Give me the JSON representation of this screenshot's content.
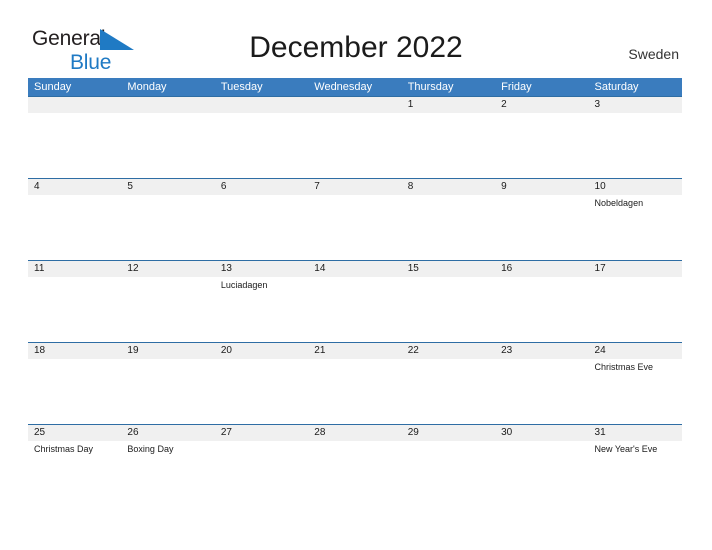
{
  "brand": {
    "word1": "General",
    "word2": "Blue",
    "flag_icon": "blue-triangle-flag-icon",
    "colors": {
      "general": "#231f20",
      "blue": "#1f7ac4",
      "flag": "#1f7ac4"
    }
  },
  "header": {
    "title": "December 2022",
    "country": "Sweden"
  },
  "theme": {
    "header_bar": "#3a7cbe",
    "row_divider": "#2e6da4",
    "date_strip": "#f0f0f0",
    "text": "#1b1b1b",
    "page_background": "#ffffff"
  },
  "calendar": {
    "weekdays": [
      "Sunday",
      "Monday",
      "Tuesday",
      "Wednesday",
      "Thursday",
      "Friday",
      "Saturday"
    ],
    "weeks": [
      {
        "dates": [
          "",
          "",
          "",
          "",
          "1",
          "2",
          "3"
        ],
        "events": [
          "",
          "",
          "",
          "",
          "",
          "",
          ""
        ]
      },
      {
        "dates": [
          "4",
          "5",
          "6",
          "7",
          "8",
          "9",
          "10"
        ],
        "events": [
          "",
          "",
          "",
          "",
          "",
          "",
          "Nobeldagen"
        ]
      },
      {
        "dates": [
          "11",
          "12",
          "13",
          "14",
          "15",
          "16",
          "17"
        ],
        "events": [
          "",
          "",
          "Luciadagen",
          "",
          "",
          "",
          ""
        ]
      },
      {
        "dates": [
          "18",
          "19",
          "20",
          "21",
          "22",
          "23",
          "24"
        ],
        "events": [
          "",
          "",
          "",
          "",
          "",
          "",
          "Christmas Eve"
        ]
      },
      {
        "dates": [
          "25",
          "26",
          "27",
          "28",
          "29",
          "30",
          "31"
        ],
        "events": [
          "Christmas Day",
          "Boxing Day",
          "",
          "",
          "",
          "",
          "New Year's Eve"
        ]
      }
    ]
  }
}
